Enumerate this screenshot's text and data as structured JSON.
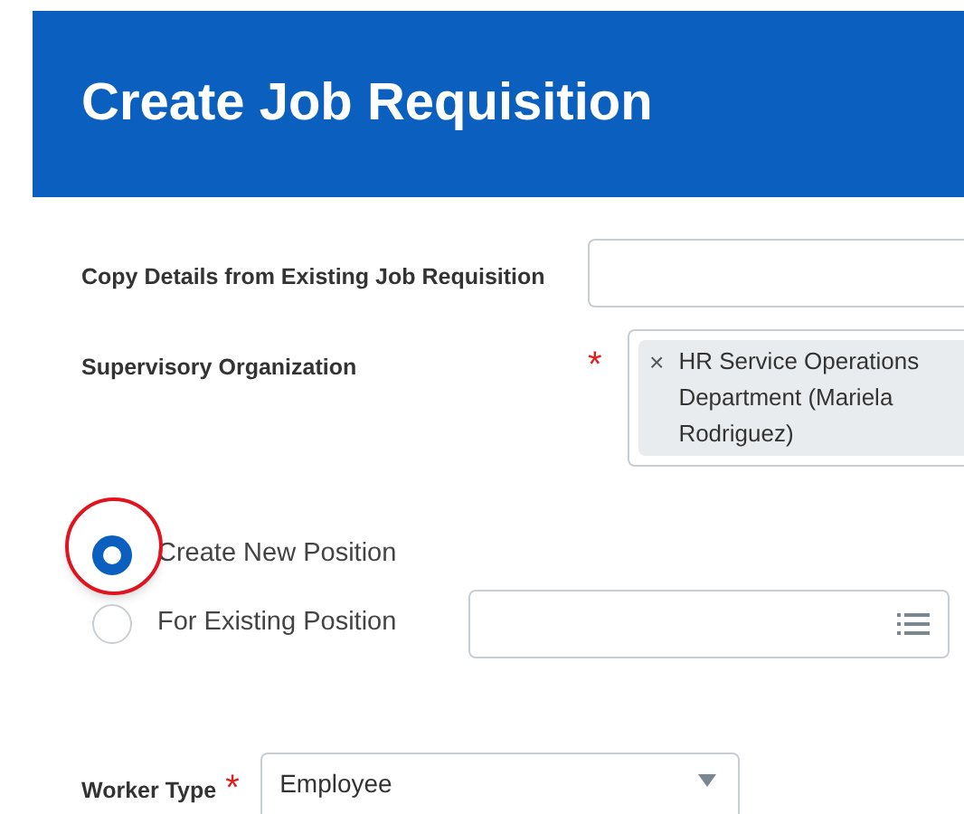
{
  "header": {
    "title": "Create Job Requisition"
  },
  "fields": [
    {
      "label": "Copy Details from Existing Job Requisition"
    },
    {
      "label": "Supervisory Organization",
      "required_mark": "*",
      "chip": "HR Service Operations Department (Mariela Rodriguez)",
      "chip_remove": "×"
    }
  ],
  "position_options": [
    {
      "label": "Create New Position",
      "selected": true,
      "kind": "plain"
    },
    {
      "label": "For Existing Position",
      "selected": false,
      "kind": "prompt"
    }
  ],
  "worker_type": {
    "label": "Worker Type",
    "required_mark": "*",
    "value": "Employee"
  }
}
